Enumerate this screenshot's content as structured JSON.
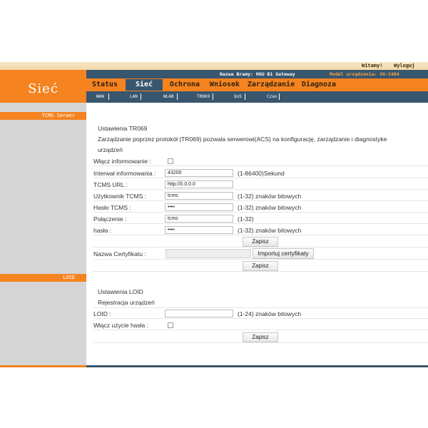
{
  "top": {
    "welcome": "Witamy!",
    "logout": "Wyloguj"
  },
  "header": {
    "logo_text": "Sieć",
    "gateway_name": "Nazwa Bramy: HGU B1 Gateway",
    "model_name": "Model urządzenia: OG-3404"
  },
  "main_nav": [
    {
      "label": "Status"
    },
    {
      "label": "Sieć"
    },
    {
      "label": "Ochrona"
    },
    {
      "label": "Wniosek"
    },
    {
      "label": "Zarządzanie"
    },
    {
      "label": "Diagnoza"
    }
  ],
  "sub_nav": [
    {
      "label": "WAN"
    },
    {
      "label": "LAN"
    },
    {
      "label": "WLAN"
    },
    {
      "label": "TR069"
    },
    {
      "label": "QoS"
    },
    {
      "label": "Czas"
    }
  ],
  "sidebar": {
    "section1": "TCMS Serwer",
    "section2": "LOID"
  },
  "tr069": {
    "heading": "Ustawienia TR069",
    "description_line1": "Zarządzanie poprzez protokół (TR069) pozwala serwerowi(ACS) na konfigurację, zarządzanie i diagnostyke",
    "description_line2": "urządzeń",
    "enable_inform_label": "Włącz informowanie :",
    "inform_interval_label": "Interwał informowania :",
    "inform_interval_value": "43200",
    "inform_interval_hint": "(1-86400)Sekund",
    "tcms_url_label": "TCMS URL :",
    "tcms_url_value": "http://0.0.0.0",
    "tcms_user_label": "Użytkownik TCMS :",
    "tcms_user_value": "tcms",
    "tcms_user_hint": "(1-32) znaków bitowych",
    "tcms_pass_label": "Hasło TCMS :",
    "tcms_pass_value": "••••",
    "tcms_pass_hint": "(1-32) znaków bitowych",
    "conn_label": "Połączenie :",
    "conn_value": "tcms",
    "conn_hint": "(1-32)",
    "conn_pass_label": "hasła :",
    "conn_pass_value": "••••",
    "conn_pass_hint": "(1-32) znaków bitowych",
    "save_label": "Zapisz",
    "cert_label": "Nazwa Certyfikatu :",
    "import_cert_label": "Importuj certyfikaty",
    "save2_label": "Zapisz"
  },
  "loid": {
    "heading": "Ustawienia LOID",
    "subheading": "Rejestracja urządzeń",
    "loid_label": "LOID :",
    "loid_value": "",
    "loid_hint": "(1-24) znaków bitowych",
    "use_pass_label": "Włącz użycie hasła :",
    "save_label": "Zapisz"
  },
  "colors": {
    "accent": "#f5831f",
    "nav_dark": "#38566e",
    "sidebar": "#d5d5d5"
  }
}
